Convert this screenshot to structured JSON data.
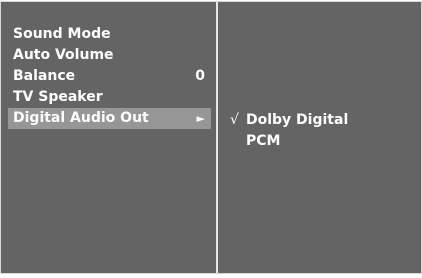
{
  "menu": {
    "items": [
      {
        "label": "Sound Mode",
        "value": ""
      },
      {
        "label": "Auto Volume",
        "value": ""
      },
      {
        "label": "Balance",
        "value": "0"
      },
      {
        "label": "TV Speaker",
        "value": ""
      },
      {
        "label": "Digital Audio Out",
        "value": "",
        "selected": true,
        "arrow": "►"
      }
    ]
  },
  "submenu": {
    "items": [
      {
        "label": "Dolby Digital",
        "checked": true,
        "check_mark": "√"
      },
      {
        "label": "PCM",
        "checked": false
      }
    ]
  },
  "colors": {
    "panel_bg": "#646464",
    "highlight_bg": "#969696",
    "text": "#ffffff",
    "divider": "#e6e6e6"
  }
}
